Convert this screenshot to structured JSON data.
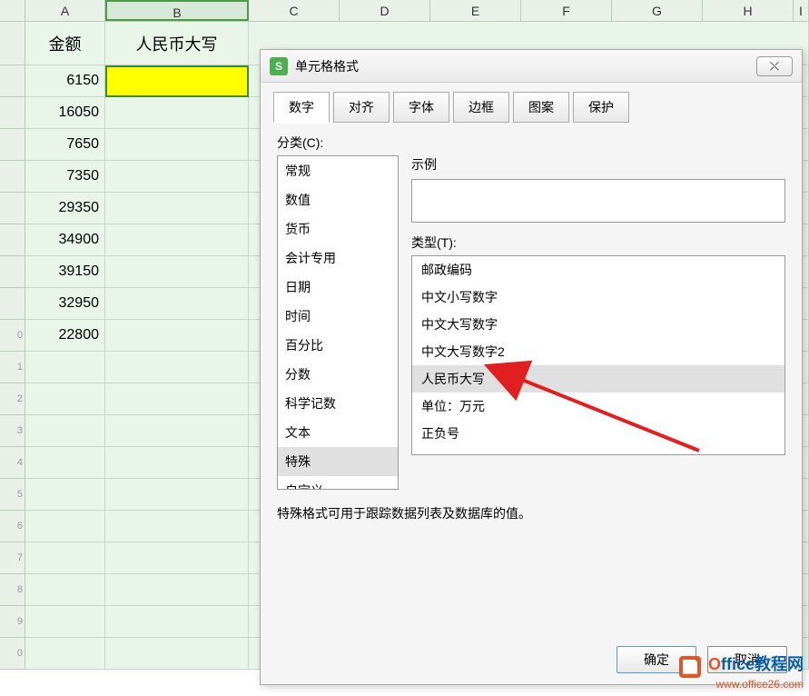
{
  "columns": [
    "A",
    "B",
    "C",
    "D",
    "E",
    "F",
    "G",
    "H",
    "I"
  ],
  "header_row": {
    "A": "金额",
    "B": "人民币大写"
  },
  "data_A": [
    "6150",
    "16050",
    "7650",
    "7350",
    "29350",
    "34900",
    "39150",
    "32950",
    "22800"
  ],
  "dialog": {
    "title": "单元格格式",
    "close": "✕",
    "tabs": [
      "数字",
      "对齐",
      "字体",
      "边框",
      "图案",
      "保护"
    ],
    "active_tab": 0,
    "category_label": "分类(C):",
    "categories": [
      "常规",
      "数值",
      "货币",
      "会计专用",
      "日期",
      "时间",
      "百分比",
      "分数",
      "科学记数",
      "文本",
      "特殊",
      "自定义"
    ],
    "selected_category_index": 10,
    "example_label": "示例",
    "type_label": "类型(T):",
    "types": [
      "邮政编码",
      "中文小写数字",
      "中文大写数字",
      "中文大写数字2",
      "人民币大写",
      "单位：万元",
      "正负号"
    ],
    "highlighted_type_index": 4,
    "description": "特殊格式可用于跟踪数据列表及数据库的值。",
    "ok": "确定",
    "cancel": "取消"
  },
  "watermark": {
    "line1_prefix": "O",
    "line1_rest": "ffice教程网",
    "line2": "www.office26.com"
  }
}
